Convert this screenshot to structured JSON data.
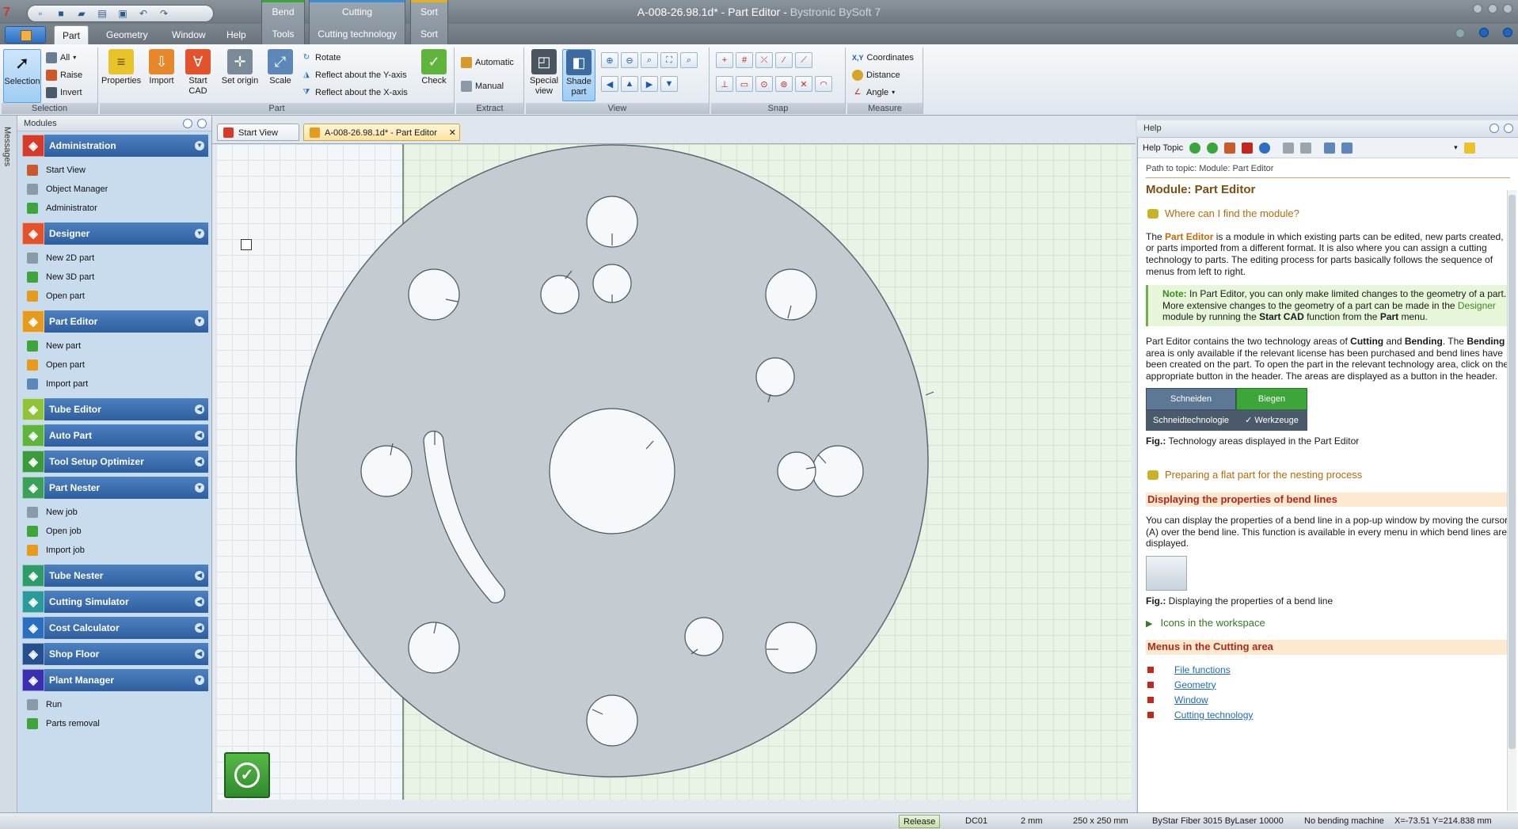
{
  "window": {
    "app_number": "7",
    "title_doc": "A-008-26.98.1d* - Part Editor",
    "title_app": "Bystronic BySoft 7"
  },
  "context_groups": [
    {
      "header": "Bend",
      "tab": "Tools",
      "color": "#3ca53a"
    },
    {
      "header": "Cutting",
      "tab": "Cutting technology",
      "color": "#3d8fd1"
    },
    {
      "header": "Sort",
      "tab": "Sort",
      "color": "#e6b021"
    }
  ],
  "tabs": [
    "Part",
    "Geometry",
    "Window",
    "Help"
  ],
  "ribbon": {
    "selection": {
      "label": "Selection",
      "group": "Selection",
      "all": "All",
      "raise": "Raise",
      "invert": "Invert"
    },
    "part": {
      "group": "Part",
      "properties": "Properties",
      "import": "Import",
      "start_cad": "Start CAD",
      "set_origin": "Set origin",
      "scale": "Scale",
      "rotate": "Rotate",
      "reflect_y": "Reflect about the Y-axis",
      "reflect_x": "Reflect about the X-axis",
      "check": "Check"
    },
    "extract": {
      "group": "Extract",
      "automatic": "Automatic",
      "manual": "Manual"
    },
    "view": {
      "group": "View",
      "special_view": "Special view",
      "shade_part": "Shade part"
    },
    "snap": {
      "group": "Snap"
    },
    "measure": {
      "group": "Measure",
      "coordinates": "Coordinates",
      "coord_prefix": "X,Y",
      "distance": "Distance",
      "angle": "Angle"
    }
  },
  "messages_label": "Messages",
  "modules": {
    "header": "Modules",
    "sections": [
      {
        "name": "Administration",
        "color": "#d63a2a",
        "expanded": true,
        "items": [
          "Start View",
          "Object Manager",
          "Administrator"
        ]
      },
      {
        "name": "Designer",
        "color": "#e2532b",
        "expanded": true,
        "items": [
          "New 2D part",
          "New 3D part",
          "Open part"
        ]
      },
      {
        "name": "Part Editor",
        "color": "#e69a1e",
        "expanded": true,
        "items": [
          "New part",
          "Open part",
          "Import part"
        ]
      },
      {
        "name": "Tube Editor",
        "color": "#8fc43a",
        "expanded": false,
        "items": []
      },
      {
        "name": "Auto Part",
        "color": "#5fb53c",
        "expanded": false,
        "items": []
      },
      {
        "name": "Tool Setup Optimizer",
        "color": "#3b9a3c",
        "expanded": false,
        "items": []
      },
      {
        "name": "Part Nester",
        "color": "#3aa05a",
        "expanded": true,
        "items": [
          "New job",
          "Open job",
          "Import job"
        ]
      },
      {
        "name": "Tube Nester",
        "color": "#2f9a6a",
        "expanded": false,
        "items": []
      },
      {
        "name": "Cutting Simulator",
        "color": "#2a9a9a",
        "expanded": false,
        "items": []
      },
      {
        "name": "Cost Calculator",
        "color": "#2a6fc0",
        "expanded": false,
        "items": []
      },
      {
        "name": "Shop Floor",
        "color": "#24508f",
        "expanded": false,
        "items": []
      },
      {
        "name": "Plant Manager",
        "color": "#3a2fb0",
        "expanded": true,
        "items": [
          "Run",
          "Parts removal"
        ]
      }
    ]
  },
  "doc_tabs": [
    "Start View",
    "A-008-26.98.1d* - Part Editor"
  ],
  "help": {
    "header": "Help",
    "topic_label": "Help Topic",
    "path": "Path to topic: Module: Part Editor",
    "title": "Module: Part Editor",
    "where_link": "Where can I find the module?",
    "para1_pre": "The ",
    "para1_hl": "Part Editor",
    "para1_post": " is a module in which existing parts can be edited, new parts created, or parts imported from a different format. It is also where you can assign a cutting technology to parts. The editing process for parts basically follows the sequence of menus from left to right.",
    "note_label": "Note:",
    "note_1": " In Part Editor, you can only make limited changes to the geometry of a part. More extensive changes to the geometry of a part can be made in the ",
    "note_designer": "Designer",
    "note_2": " module by running the ",
    "note_startcad": "Start CAD",
    "note_3": " function from the ",
    "note_part": "Part",
    "note_4": " menu.",
    "para2_1": "Part Editor contains the two technology areas of ",
    "para2_cutting": "Cutting",
    "para2_and": " and ",
    "para2_bending": "Bending",
    "para2_2": ". The ",
    "para2_bending2": "Bending",
    "para2_3": " area is only available if the relevant license has been purchased and bend lines have been created on the part. To open the part in the relevant technology area, click on the appropriate button in the header. The areas are displayed as a button in the header.",
    "tech_fig": {
      "schneiden": "Schneiden",
      "biegen": "Biegen",
      "schneidtech": "Schneidtechnologie",
      "werkzeuge": "✓ Werkzeuge"
    },
    "fig_label": "Fig.:",
    "fig1_caption": " Technology areas displayed in the Part Editor",
    "prep_link": "Preparing a flat part for the nesting process",
    "sec_bend": "Displaying the properties of bend lines",
    "bend_para": "You can display the properties of a bend line in a pop-up window by moving the cursor (A) over the bend line. This function is available in every menu in which bend lines are displayed.",
    "fig2_caption": " Displaying the properties of a bend line",
    "icons_link": "Icons in the workspace",
    "sec_menus": "Menus in the Cutting area",
    "menu_links": [
      "File functions",
      "Geometry",
      "Window",
      "Cutting technology"
    ]
  },
  "status": {
    "release": "Release",
    "dc": "DC01",
    "thickness": "2 mm",
    "sheet": "250 x 250 mm",
    "machine": "ByStar Fiber 3015 ByLaser 10000",
    "bending": "No bending machine",
    "coords": "X=-73.51  Y=214.838 mm"
  },
  "colors": {
    "accent": "#2f5e9e",
    "part_fill": "#c5ccd1",
    "ok_green": "#3fa335"
  }
}
